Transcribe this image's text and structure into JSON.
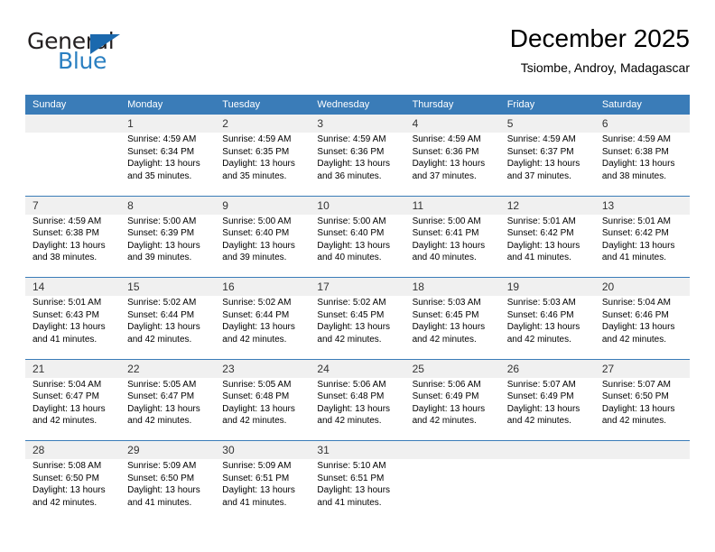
{
  "brand": {
    "name_top": "General",
    "name_bottom": "Blue",
    "triangle_color": "#1b69ae",
    "text_color_top": "#231f20",
    "text_color_bottom": "#2a7fc1"
  },
  "header": {
    "title": "December 2025",
    "subtitle": "Tsiombe, Androy, Madagascar"
  },
  "theme": {
    "header_bg": "#3a7cb8",
    "header_text": "#ffffff",
    "weeknum_bg": "#f0f0f0",
    "cell_bg": "#ffffff",
    "rule_color": "#3a7cb8"
  },
  "calendar": {
    "weekday_headers": [
      "Sunday",
      "Monday",
      "Tuesday",
      "Wednesday",
      "Thursday",
      "Friday",
      "Saturday"
    ],
    "weeks": [
      {
        "days": [
          {
            "num": "",
            "lines": [
              "",
              "",
              "",
              ""
            ]
          },
          {
            "num": "1",
            "lines": [
              "Sunrise: 4:59 AM",
              "Sunset: 6:34 PM",
              "Daylight: 13 hours",
              "and 35 minutes."
            ]
          },
          {
            "num": "2",
            "lines": [
              "Sunrise: 4:59 AM",
              "Sunset: 6:35 PM",
              "Daylight: 13 hours",
              "and 35 minutes."
            ]
          },
          {
            "num": "3",
            "lines": [
              "Sunrise: 4:59 AM",
              "Sunset: 6:36 PM",
              "Daylight: 13 hours",
              "and 36 minutes."
            ]
          },
          {
            "num": "4",
            "lines": [
              "Sunrise: 4:59 AM",
              "Sunset: 6:36 PM",
              "Daylight: 13 hours",
              "and 37 minutes."
            ]
          },
          {
            "num": "5",
            "lines": [
              "Sunrise: 4:59 AM",
              "Sunset: 6:37 PM",
              "Daylight: 13 hours",
              "and 37 minutes."
            ]
          },
          {
            "num": "6",
            "lines": [
              "Sunrise: 4:59 AM",
              "Sunset: 6:38 PM",
              "Daylight: 13 hours",
              "and 38 minutes."
            ]
          }
        ]
      },
      {
        "days": [
          {
            "num": "7",
            "lines": [
              "Sunrise: 4:59 AM",
              "Sunset: 6:38 PM",
              "Daylight: 13 hours",
              "and 38 minutes."
            ]
          },
          {
            "num": "8",
            "lines": [
              "Sunrise: 5:00 AM",
              "Sunset: 6:39 PM",
              "Daylight: 13 hours",
              "and 39 minutes."
            ]
          },
          {
            "num": "9",
            "lines": [
              "Sunrise: 5:00 AM",
              "Sunset: 6:40 PM",
              "Daylight: 13 hours",
              "and 39 minutes."
            ]
          },
          {
            "num": "10",
            "lines": [
              "Sunrise: 5:00 AM",
              "Sunset: 6:40 PM",
              "Daylight: 13 hours",
              "and 40 minutes."
            ]
          },
          {
            "num": "11",
            "lines": [
              "Sunrise: 5:00 AM",
              "Sunset: 6:41 PM",
              "Daylight: 13 hours",
              "and 40 minutes."
            ]
          },
          {
            "num": "12",
            "lines": [
              "Sunrise: 5:01 AM",
              "Sunset: 6:42 PM",
              "Daylight: 13 hours",
              "and 41 minutes."
            ]
          },
          {
            "num": "13",
            "lines": [
              "Sunrise: 5:01 AM",
              "Sunset: 6:42 PM",
              "Daylight: 13 hours",
              "and 41 minutes."
            ]
          }
        ]
      },
      {
        "days": [
          {
            "num": "14",
            "lines": [
              "Sunrise: 5:01 AM",
              "Sunset: 6:43 PM",
              "Daylight: 13 hours",
              "and 41 minutes."
            ]
          },
          {
            "num": "15",
            "lines": [
              "Sunrise: 5:02 AM",
              "Sunset: 6:44 PM",
              "Daylight: 13 hours",
              "and 42 minutes."
            ]
          },
          {
            "num": "16",
            "lines": [
              "Sunrise: 5:02 AM",
              "Sunset: 6:44 PM",
              "Daylight: 13 hours",
              "and 42 minutes."
            ]
          },
          {
            "num": "17",
            "lines": [
              "Sunrise: 5:02 AM",
              "Sunset: 6:45 PM",
              "Daylight: 13 hours",
              "and 42 minutes."
            ]
          },
          {
            "num": "18",
            "lines": [
              "Sunrise: 5:03 AM",
              "Sunset: 6:45 PM",
              "Daylight: 13 hours",
              "and 42 minutes."
            ]
          },
          {
            "num": "19",
            "lines": [
              "Sunrise: 5:03 AM",
              "Sunset: 6:46 PM",
              "Daylight: 13 hours",
              "and 42 minutes."
            ]
          },
          {
            "num": "20",
            "lines": [
              "Sunrise: 5:04 AM",
              "Sunset: 6:46 PM",
              "Daylight: 13 hours",
              "and 42 minutes."
            ]
          }
        ]
      },
      {
        "days": [
          {
            "num": "21",
            "lines": [
              "Sunrise: 5:04 AM",
              "Sunset: 6:47 PM",
              "Daylight: 13 hours",
              "and 42 minutes."
            ]
          },
          {
            "num": "22",
            "lines": [
              "Sunrise: 5:05 AM",
              "Sunset: 6:47 PM",
              "Daylight: 13 hours",
              "and 42 minutes."
            ]
          },
          {
            "num": "23",
            "lines": [
              "Sunrise: 5:05 AM",
              "Sunset: 6:48 PM",
              "Daylight: 13 hours",
              "and 42 minutes."
            ]
          },
          {
            "num": "24",
            "lines": [
              "Sunrise: 5:06 AM",
              "Sunset: 6:48 PM",
              "Daylight: 13 hours",
              "and 42 minutes."
            ]
          },
          {
            "num": "25",
            "lines": [
              "Sunrise: 5:06 AM",
              "Sunset: 6:49 PM",
              "Daylight: 13 hours",
              "and 42 minutes."
            ]
          },
          {
            "num": "26",
            "lines": [
              "Sunrise: 5:07 AM",
              "Sunset: 6:49 PM",
              "Daylight: 13 hours",
              "and 42 minutes."
            ]
          },
          {
            "num": "27",
            "lines": [
              "Sunrise: 5:07 AM",
              "Sunset: 6:50 PM",
              "Daylight: 13 hours",
              "and 42 minutes."
            ]
          }
        ]
      },
      {
        "days": [
          {
            "num": "28",
            "lines": [
              "Sunrise: 5:08 AM",
              "Sunset: 6:50 PM",
              "Daylight: 13 hours",
              "and 42 minutes."
            ]
          },
          {
            "num": "29",
            "lines": [
              "Sunrise: 5:09 AM",
              "Sunset: 6:50 PM",
              "Daylight: 13 hours",
              "and 41 minutes."
            ]
          },
          {
            "num": "30",
            "lines": [
              "Sunrise: 5:09 AM",
              "Sunset: 6:51 PM",
              "Daylight: 13 hours",
              "and 41 minutes."
            ]
          },
          {
            "num": "31",
            "lines": [
              "Sunrise: 5:10 AM",
              "Sunset: 6:51 PM",
              "Daylight: 13 hours",
              "and 41 minutes."
            ]
          },
          {
            "num": "",
            "lines": [
              "",
              "",
              "",
              ""
            ]
          },
          {
            "num": "",
            "lines": [
              "",
              "",
              "",
              ""
            ]
          },
          {
            "num": "",
            "lines": [
              "",
              "",
              "",
              ""
            ]
          }
        ]
      }
    ]
  }
}
